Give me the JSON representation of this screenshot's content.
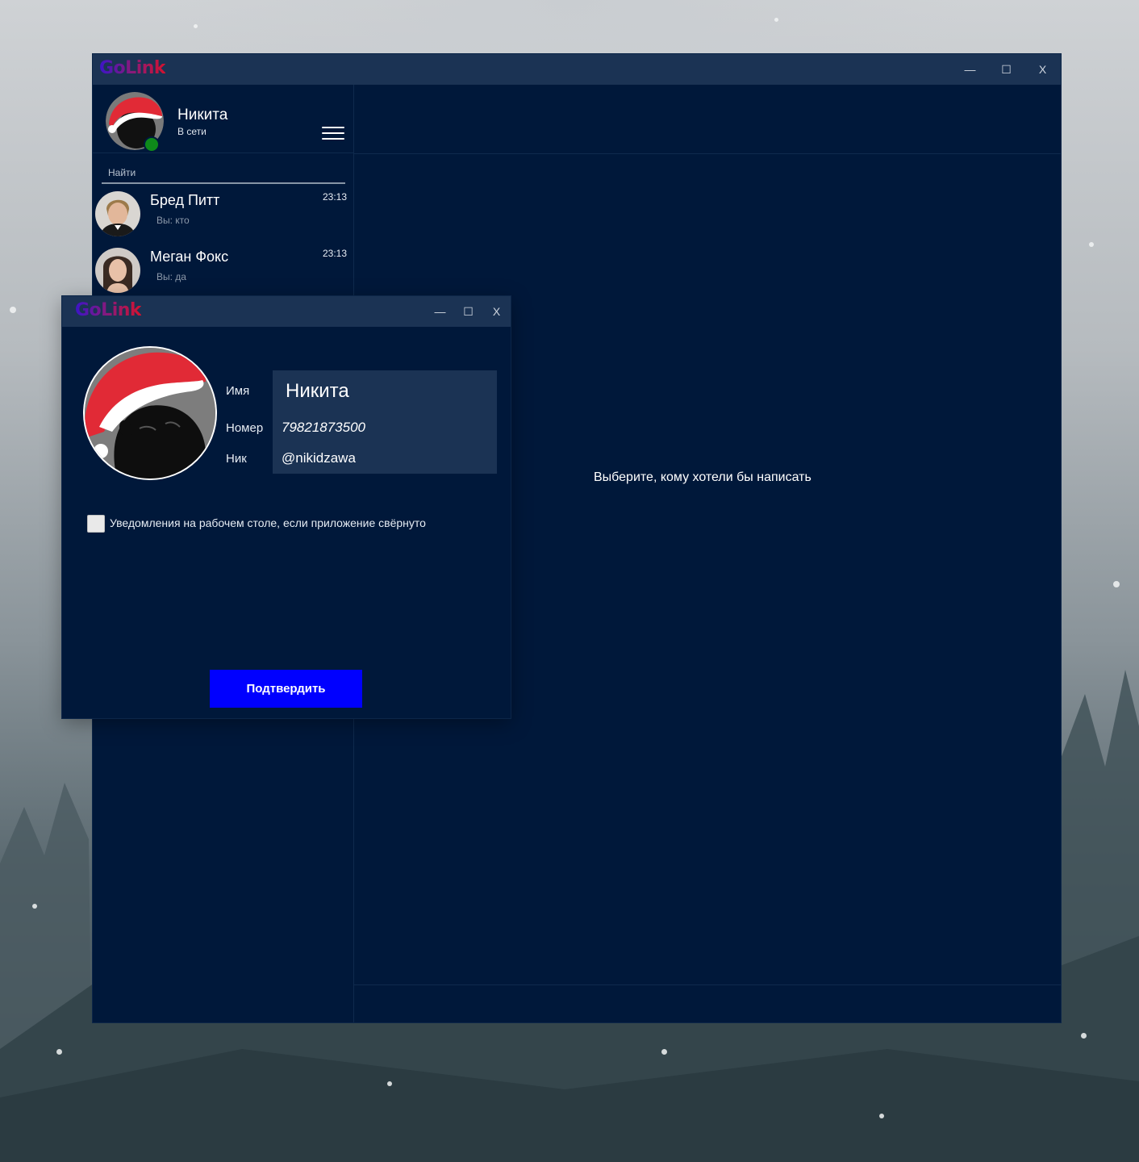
{
  "app": {
    "logo_text": "GoLink",
    "window_controls": {
      "minimize": "—",
      "maximize": "☐",
      "close": "X"
    }
  },
  "sidebar": {
    "profile": {
      "name": "Никита",
      "status": "В сети"
    },
    "search": {
      "label": "Найти"
    },
    "chats": [
      {
        "name": "Бред Питт",
        "time": "23:13",
        "preview": "Вы: кто"
      },
      {
        "name": "Меган Фокс",
        "time": "23:13",
        "preview": "Вы: да"
      }
    ]
  },
  "chat_panel": {
    "empty_message": "Выберите, кому хотели бы написать"
  },
  "profile_dialog": {
    "logo_text": "GoLink",
    "window_controls": {
      "minimize": "—",
      "maximize": "☐",
      "close": "X"
    },
    "fields": {
      "name_label": "Имя",
      "name_value": "Никита",
      "phone_label": "Номер",
      "phone_value": "79821873500",
      "nick_label": "Ник",
      "nick_value": "@nikidzawa"
    },
    "notifications": {
      "label": "Уведомления на рабочем столе,  если приложение свёрнуто",
      "checked": false
    },
    "confirm_label": "Подтвердить"
  },
  "colors": {
    "window_bg": "#00183a",
    "titlebar_bg": "#1b3354",
    "accent_button": "#0000ff",
    "online": "#0e8a1a",
    "logo_gradient": [
      "#3b14c9",
      "#d4122e"
    ]
  }
}
